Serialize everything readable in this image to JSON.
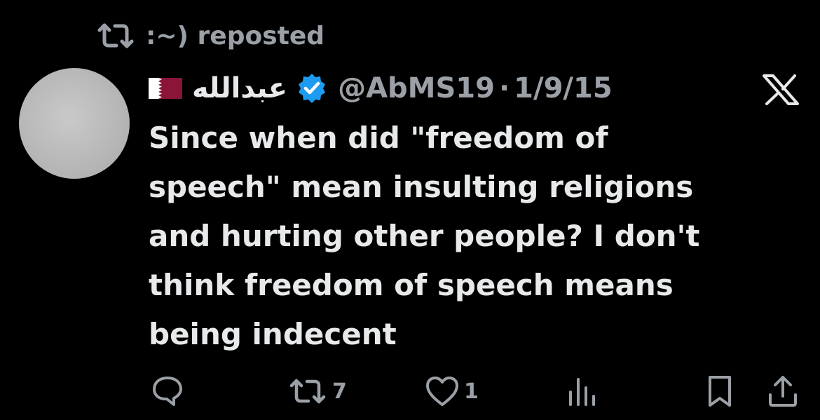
{
  "repost_bar": {
    "icon": "repost-icon",
    "text": ":~) reposted"
  },
  "author": {
    "flag_icon": "qatar-flag-icon",
    "display_name": "عبدالله",
    "verified_icon": "verified-badge-icon",
    "handle": "@AbMS19",
    "separator": "·",
    "date": "1/9/15"
  },
  "brand_icon": "x-logo-icon",
  "tweet": {
    "lines": [
      "Since when did \"freedom of",
      "speech\" mean insulting religions",
      "and hurting other people? I don't",
      "think freedom of speech means",
      "being indecent"
    ]
  },
  "actions": {
    "reply": {
      "icon": "reply-icon"
    },
    "repost": {
      "icon": "repost-icon",
      "count": "7"
    },
    "like": {
      "icon": "heart-icon",
      "count": "1"
    },
    "views": {
      "icon": "views-chart-icon"
    },
    "bookmark": {
      "icon": "bookmark-icon"
    },
    "share": {
      "icon": "share-icon"
    }
  },
  "colors": {
    "background": "#000000",
    "text_primary": "#e7e9ea",
    "text_secondary": "#9aa0a6",
    "verified_blue": "#1d9bf0",
    "qatar_maroon": "#8a1538"
  }
}
